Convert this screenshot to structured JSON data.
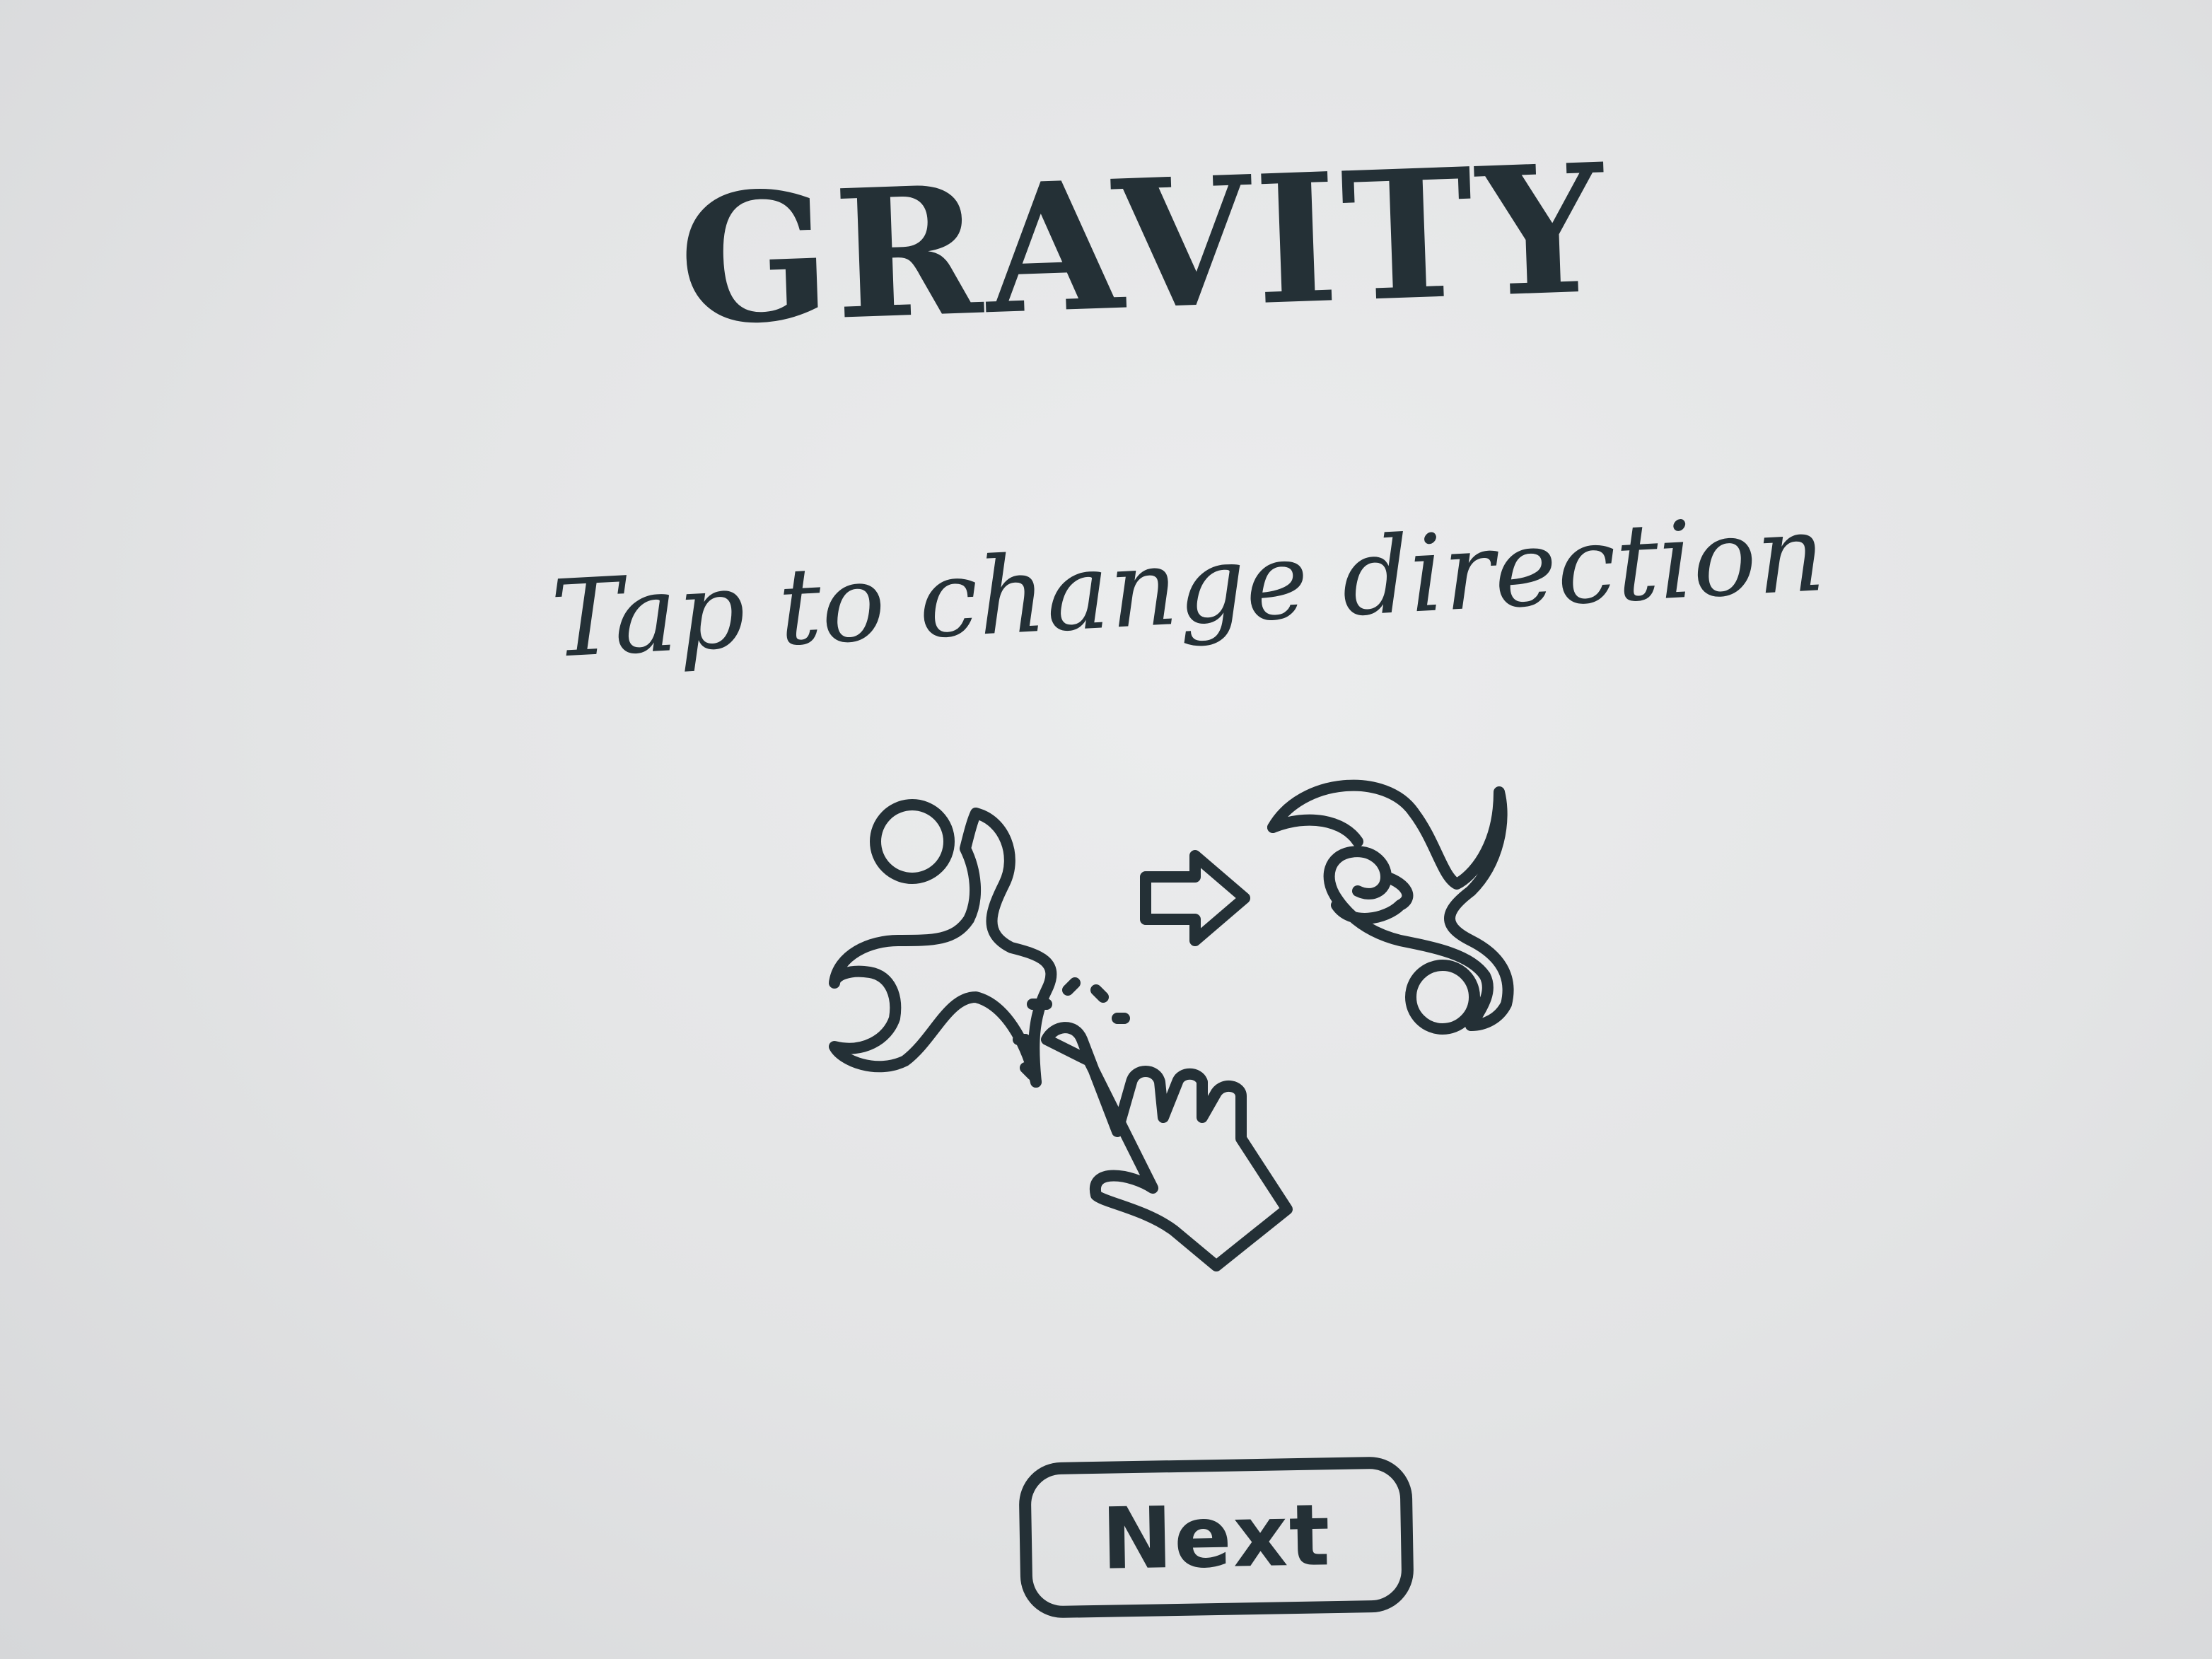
{
  "screen": {
    "title": "GRAVITY",
    "instruction": "Tap to change direction"
  },
  "illustration": {
    "icons": [
      "character-icon",
      "arrow-right-icon",
      "character-flipped-icon",
      "tap-hand-icon"
    ]
  },
  "actions": {
    "next_label": "Next"
  },
  "colors": {
    "ink": "#243036",
    "paper": "#e4e5e6"
  }
}
